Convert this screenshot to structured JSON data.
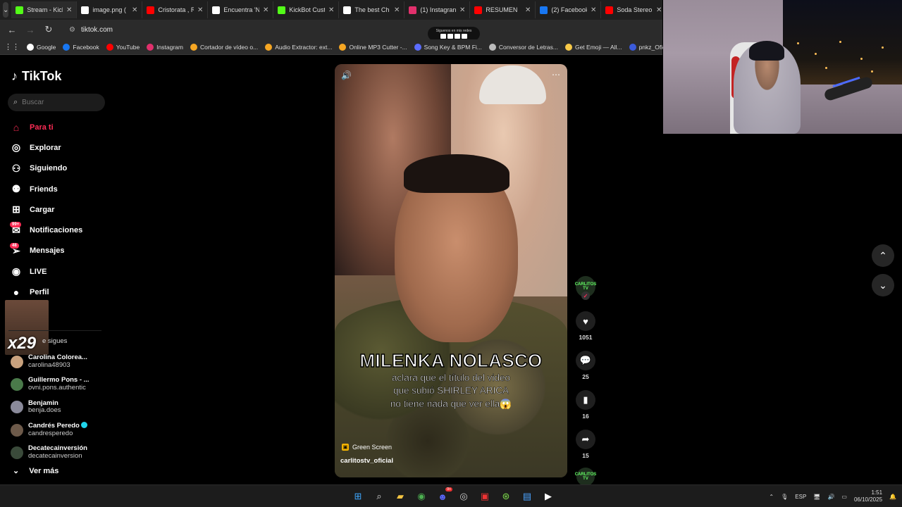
{
  "browser": {
    "tabs": [
      {
        "title": "Stream - Kick",
        "color": "#53fc18"
      },
      {
        "title": "image.png (",
        "color": "#ffffff"
      },
      {
        "title": "Cristorata , R",
        "color": "#ff0000"
      },
      {
        "title": "Encuentra 'N",
        "color": "#ffffff"
      },
      {
        "title": "KickBot Cust",
        "color": "#53fc18"
      },
      {
        "title": "The best Ch",
        "color": "#ffffff"
      },
      {
        "title": "(1) Instagran",
        "color": "#e1306c"
      },
      {
        "title": "RESUMEN",
        "color": "#ff0000"
      },
      {
        "title": "(2) Facebook",
        "color": "#1877f2"
      },
      {
        "title": "Soda Stereo",
        "color": "#ff0000"
      }
    ],
    "url": "tiktok.com",
    "promo_text": "Siguenos en mis redes",
    "bookmarks": [
      {
        "label": "Google",
        "color": "#ffffff"
      },
      {
        "label": "Facebook",
        "color": "#1877f2"
      },
      {
        "label": "YouTube",
        "color": "#ff0000"
      },
      {
        "label": "Instagram",
        "color": "#e1306c"
      },
      {
        "label": "Cortador de vídeo o...",
        "color": "#f5a623"
      },
      {
        "label": "Audio Extractor: ext...",
        "color": "#f5a623"
      },
      {
        "label": "Online MP3 Cutter -...",
        "color": "#f5a623"
      },
      {
        "label": "Song Key & BPM Fi...",
        "color": "#5b6cff"
      },
      {
        "label": "Conversor de Letras...",
        "color": "#bbbbbb"
      },
      {
        "label": "Get Emoji — All...",
        "color": "#f7c948"
      },
      {
        "label": "pnkz_Oficial",
        "color": "#3b5bdb"
      }
    ]
  },
  "tiktok": {
    "logo": "TikTok",
    "search_placeholder": "Buscar",
    "nav": [
      {
        "label": "Para ti",
        "icon": "home-icon",
        "glyph": "⌂",
        "active": true
      },
      {
        "label": "Explorar",
        "icon": "compass-icon",
        "glyph": "◎"
      },
      {
        "label": "Siguiendo",
        "icon": "following-icon",
        "glyph": "⚇"
      },
      {
        "label": "Friends",
        "icon": "friends-icon",
        "glyph": "⚉"
      },
      {
        "label": "Cargar",
        "icon": "upload-icon",
        "glyph": "⊞"
      },
      {
        "label": "Notificaciones",
        "icon": "notifications-icon",
        "glyph": "✉",
        "badge": "99+"
      },
      {
        "label": "Mensajes",
        "icon": "messages-icon",
        "glyph": "➢",
        "badge": "48"
      },
      {
        "label": "LIVE",
        "icon": "live-icon",
        "glyph": "◉"
      },
      {
        "label": "Perfil",
        "icon": "profile-icon",
        "glyph": "●"
      }
    ],
    "overlay_counter": "x29",
    "following_header": "e sigues",
    "following": [
      {
        "name": "Carolina Colorea...",
        "handle": "carolina48903",
        "color": "#c9a27e"
      },
      {
        "name": "Guillermo Pons - ...",
        "handle": "ovni.pons.authentic",
        "color": "#4a7a4a"
      },
      {
        "name": "Benjamin",
        "handle": "benja.does",
        "color": "#8a8a9a"
      },
      {
        "name": "Candrés Peredo",
        "handle": "candresperedo",
        "color": "#6d5a4a",
        "verified": true
      },
      {
        "name": "Decatecainversión",
        "handle": "decatecainversion",
        "color": "#3a4a3a"
      }
    ],
    "see_more": "Ver más"
  },
  "video": {
    "title": "MILENKA NOLASCO",
    "subtitle_lines": [
      "aclara que el título del video",
      "que subió SHIRLEY ARICA",
      "no tiene nada que ver ella😱"
    ],
    "effect": "Green Screen",
    "author": "carlitostv_oficial",
    "likes": "1051",
    "comments": "25",
    "saves": "16",
    "shares": "15",
    "creator_badge": "CARLITOS TV"
  },
  "taskbar": {
    "language": "ESP",
    "time": "1:51",
    "date": "06/10/2025",
    "discord_badge": "9+"
  }
}
